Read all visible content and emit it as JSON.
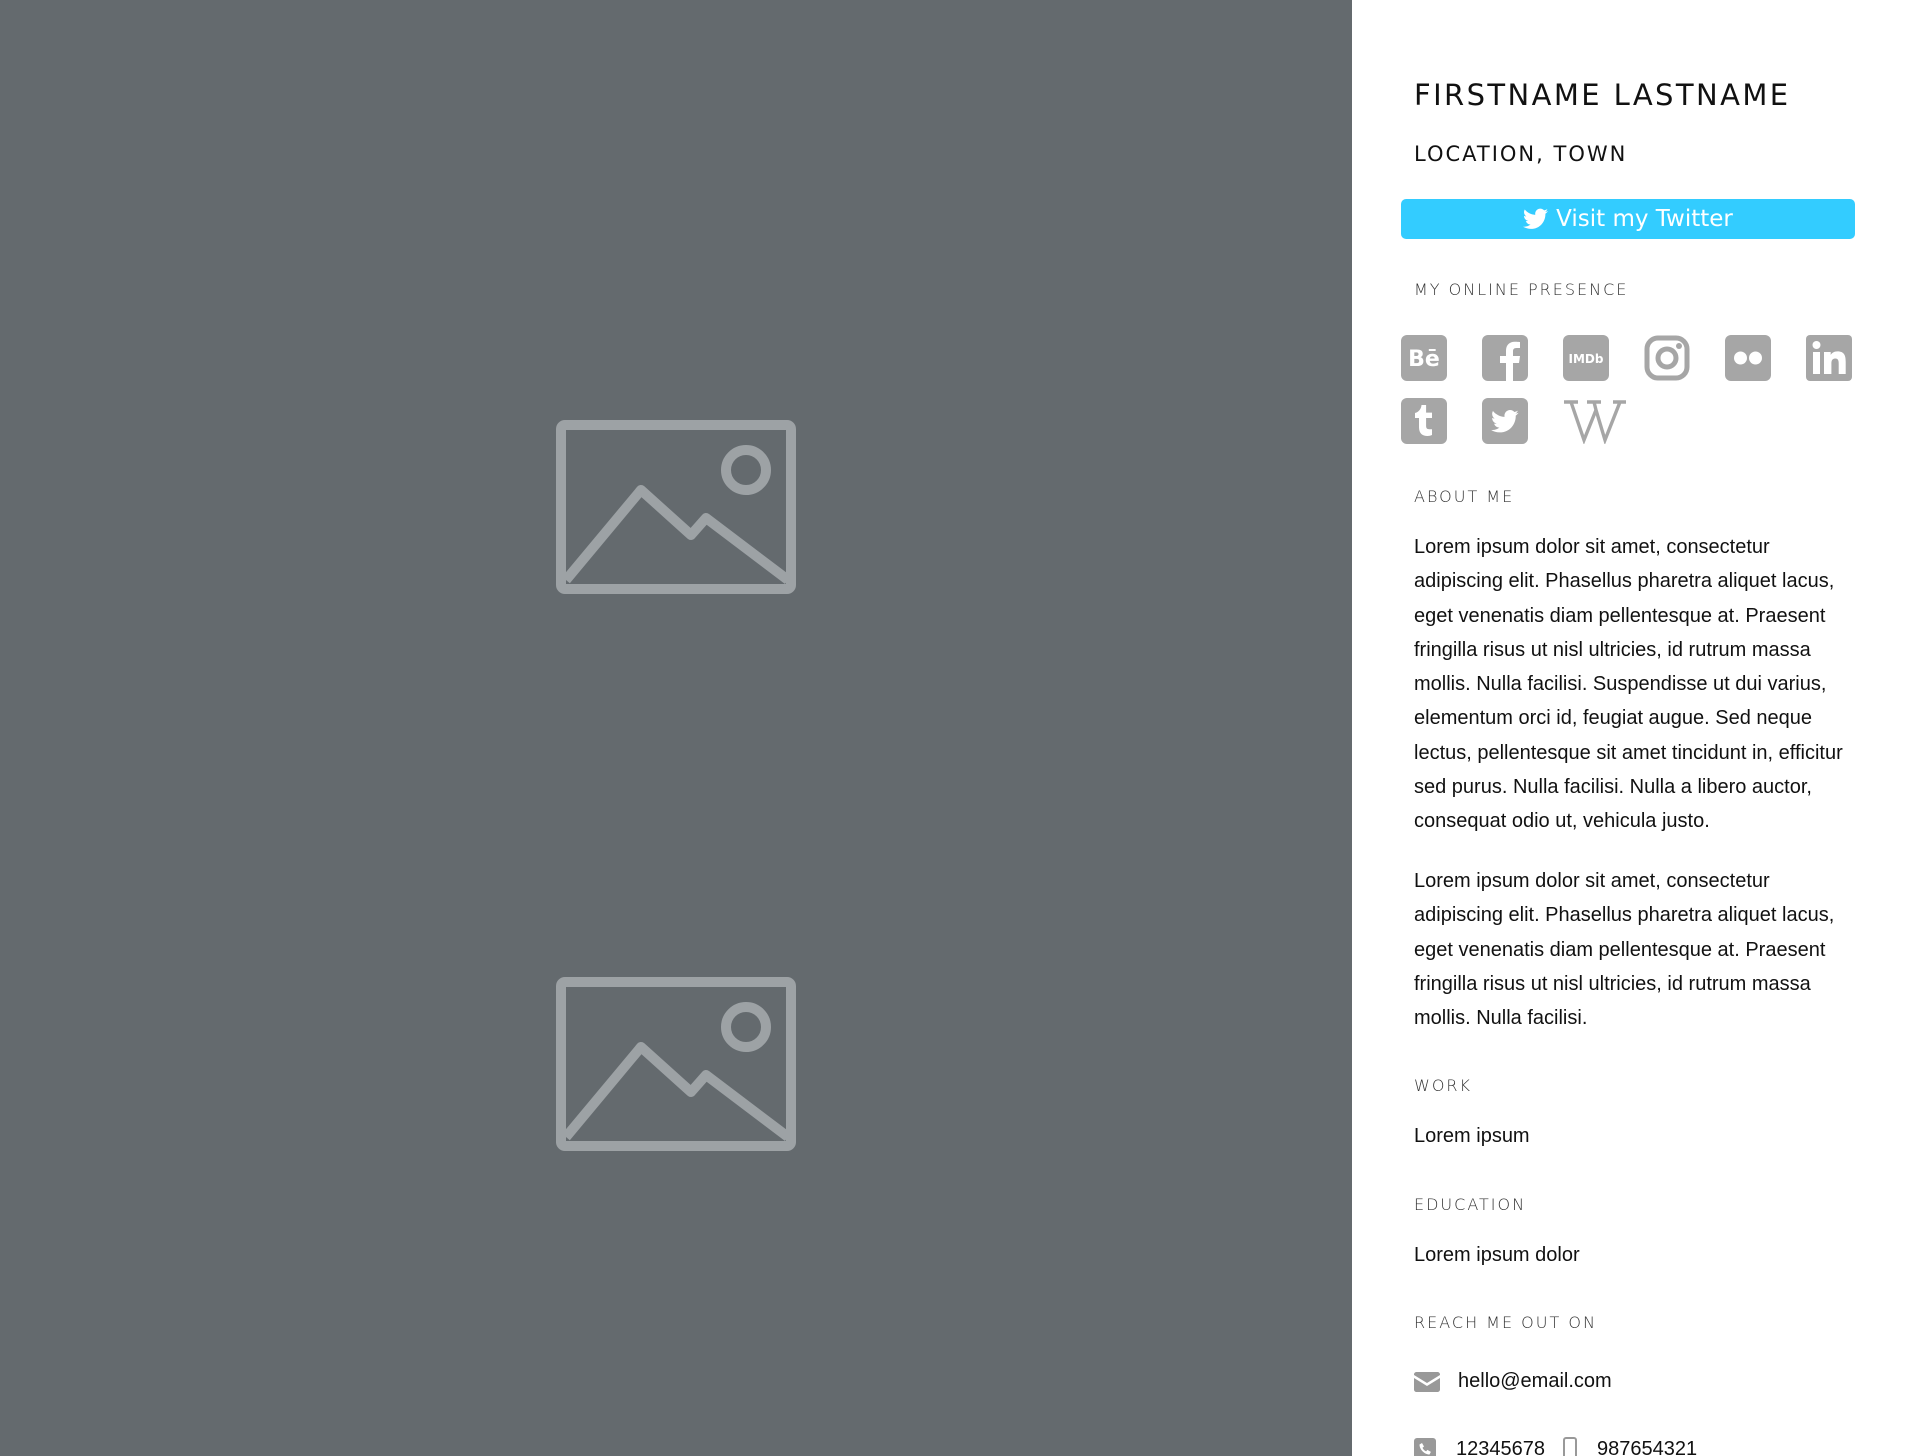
{
  "profile": {
    "name": "FIRSTNAME LASTNAME",
    "location": "LOCATION, TOWN",
    "twitter_button_label": "Visit my Twitter"
  },
  "online_presence": {
    "heading": "MY ONLINE PRESENCE",
    "icons": [
      "behance-icon",
      "facebook-icon",
      "imdb-icon",
      "instagram-icon",
      "flickr-icon",
      "linkedin-icon",
      "tumblr-icon",
      "twitter-icon",
      "wikipedia-icon"
    ],
    "imdb_text": "IMDb",
    "behance_text": "Bē"
  },
  "about": {
    "heading": "ABOUT ME",
    "paragraph1": "Lorem ipsum dolor sit amet, consectetur adipiscing elit. Phasellus pharetra aliquet lacus, eget venenatis diam pellentesque at. Praesent fringilla risus ut nisl ultricies, id rutrum massa mollis. Nulla facilisi. Suspendisse ut dui varius, elementum orci id, feugiat augue. Sed neque lectus, pellentesque sit amet tincidunt in, efficitur sed purus. Nulla facilisi. Nulla a libero auctor, consequat odio ut, vehicula justo.",
    "paragraph2": "Lorem ipsum dolor sit amet, consectetur adipiscing elit. Phasellus pharetra aliquet lacus, eget venenatis diam pellentesque at. Praesent fringilla risus ut nisl ultricies, id rutrum massa mollis. Nulla facilisi."
  },
  "work": {
    "heading": "WORK",
    "value": "Lorem ipsum"
  },
  "education": {
    "heading": "EDUCATION",
    "value": "Lorem ipsum dolor"
  },
  "contact": {
    "heading": "REACH ME OUT ON",
    "email": "hello@email.com",
    "phone": "12345678",
    "mobile": "987654321"
  },
  "colors": {
    "gallery_bg": "#646a6e",
    "placeholder_icon": "#9da2a5",
    "twitter_button": "#33ccff",
    "social_icon": "#a6a6a6"
  }
}
